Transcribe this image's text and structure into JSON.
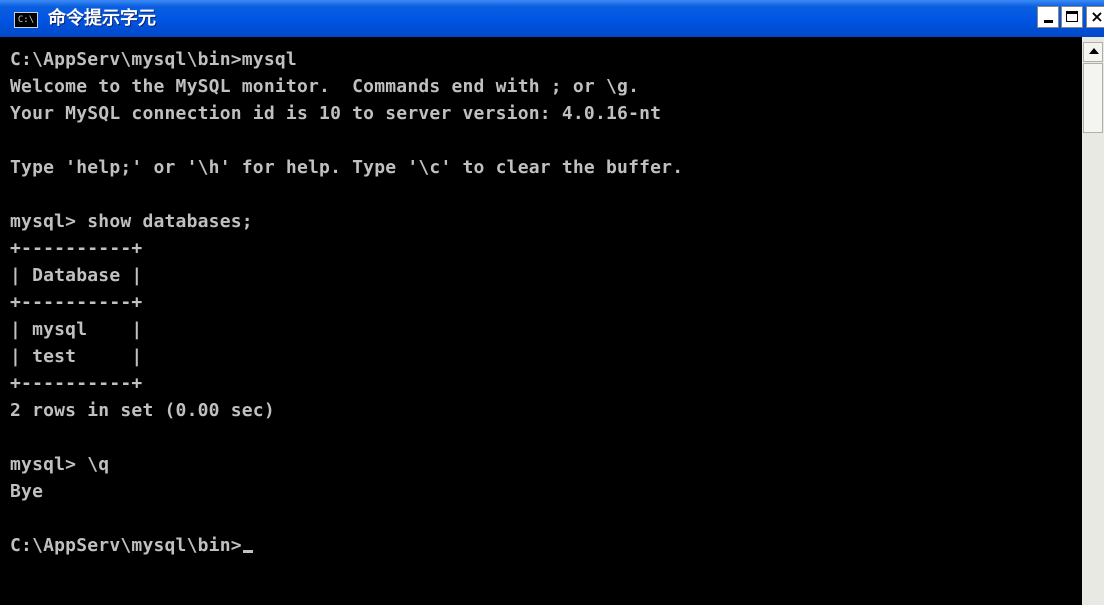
{
  "window": {
    "title": "命令提示字元",
    "icon_label": "C:\\",
    "buttons": {
      "minimize": "minimize-icon",
      "maximize": "maximize-icon",
      "close": "×"
    }
  },
  "console": {
    "lines": [
      "C:\\AppServ\\mysql\\bin>mysql",
      "Welcome to the MySQL monitor.  Commands end with ; or \\g.",
      "Your MySQL connection id is 10 to server version: 4.0.16-nt",
      "",
      "Type 'help;' or '\\h' for help. Type '\\c' to clear the buffer.",
      "",
      "mysql> show databases;",
      "+----------+",
      "| Database |",
      "+----------+",
      "| mysql    |",
      "| test     |",
      "+----------+",
      "2 rows in set (0.00 sec)",
      "",
      "mysql> \\q",
      "Bye",
      "",
      "C:\\AppServ\\mysql\\bin>"
    ]
  },
  "colors": {
    "titlebar": "#0054e3",
    "console_bg": "#000000",
    "console_fg": "#c0c0c0"
  }
}
